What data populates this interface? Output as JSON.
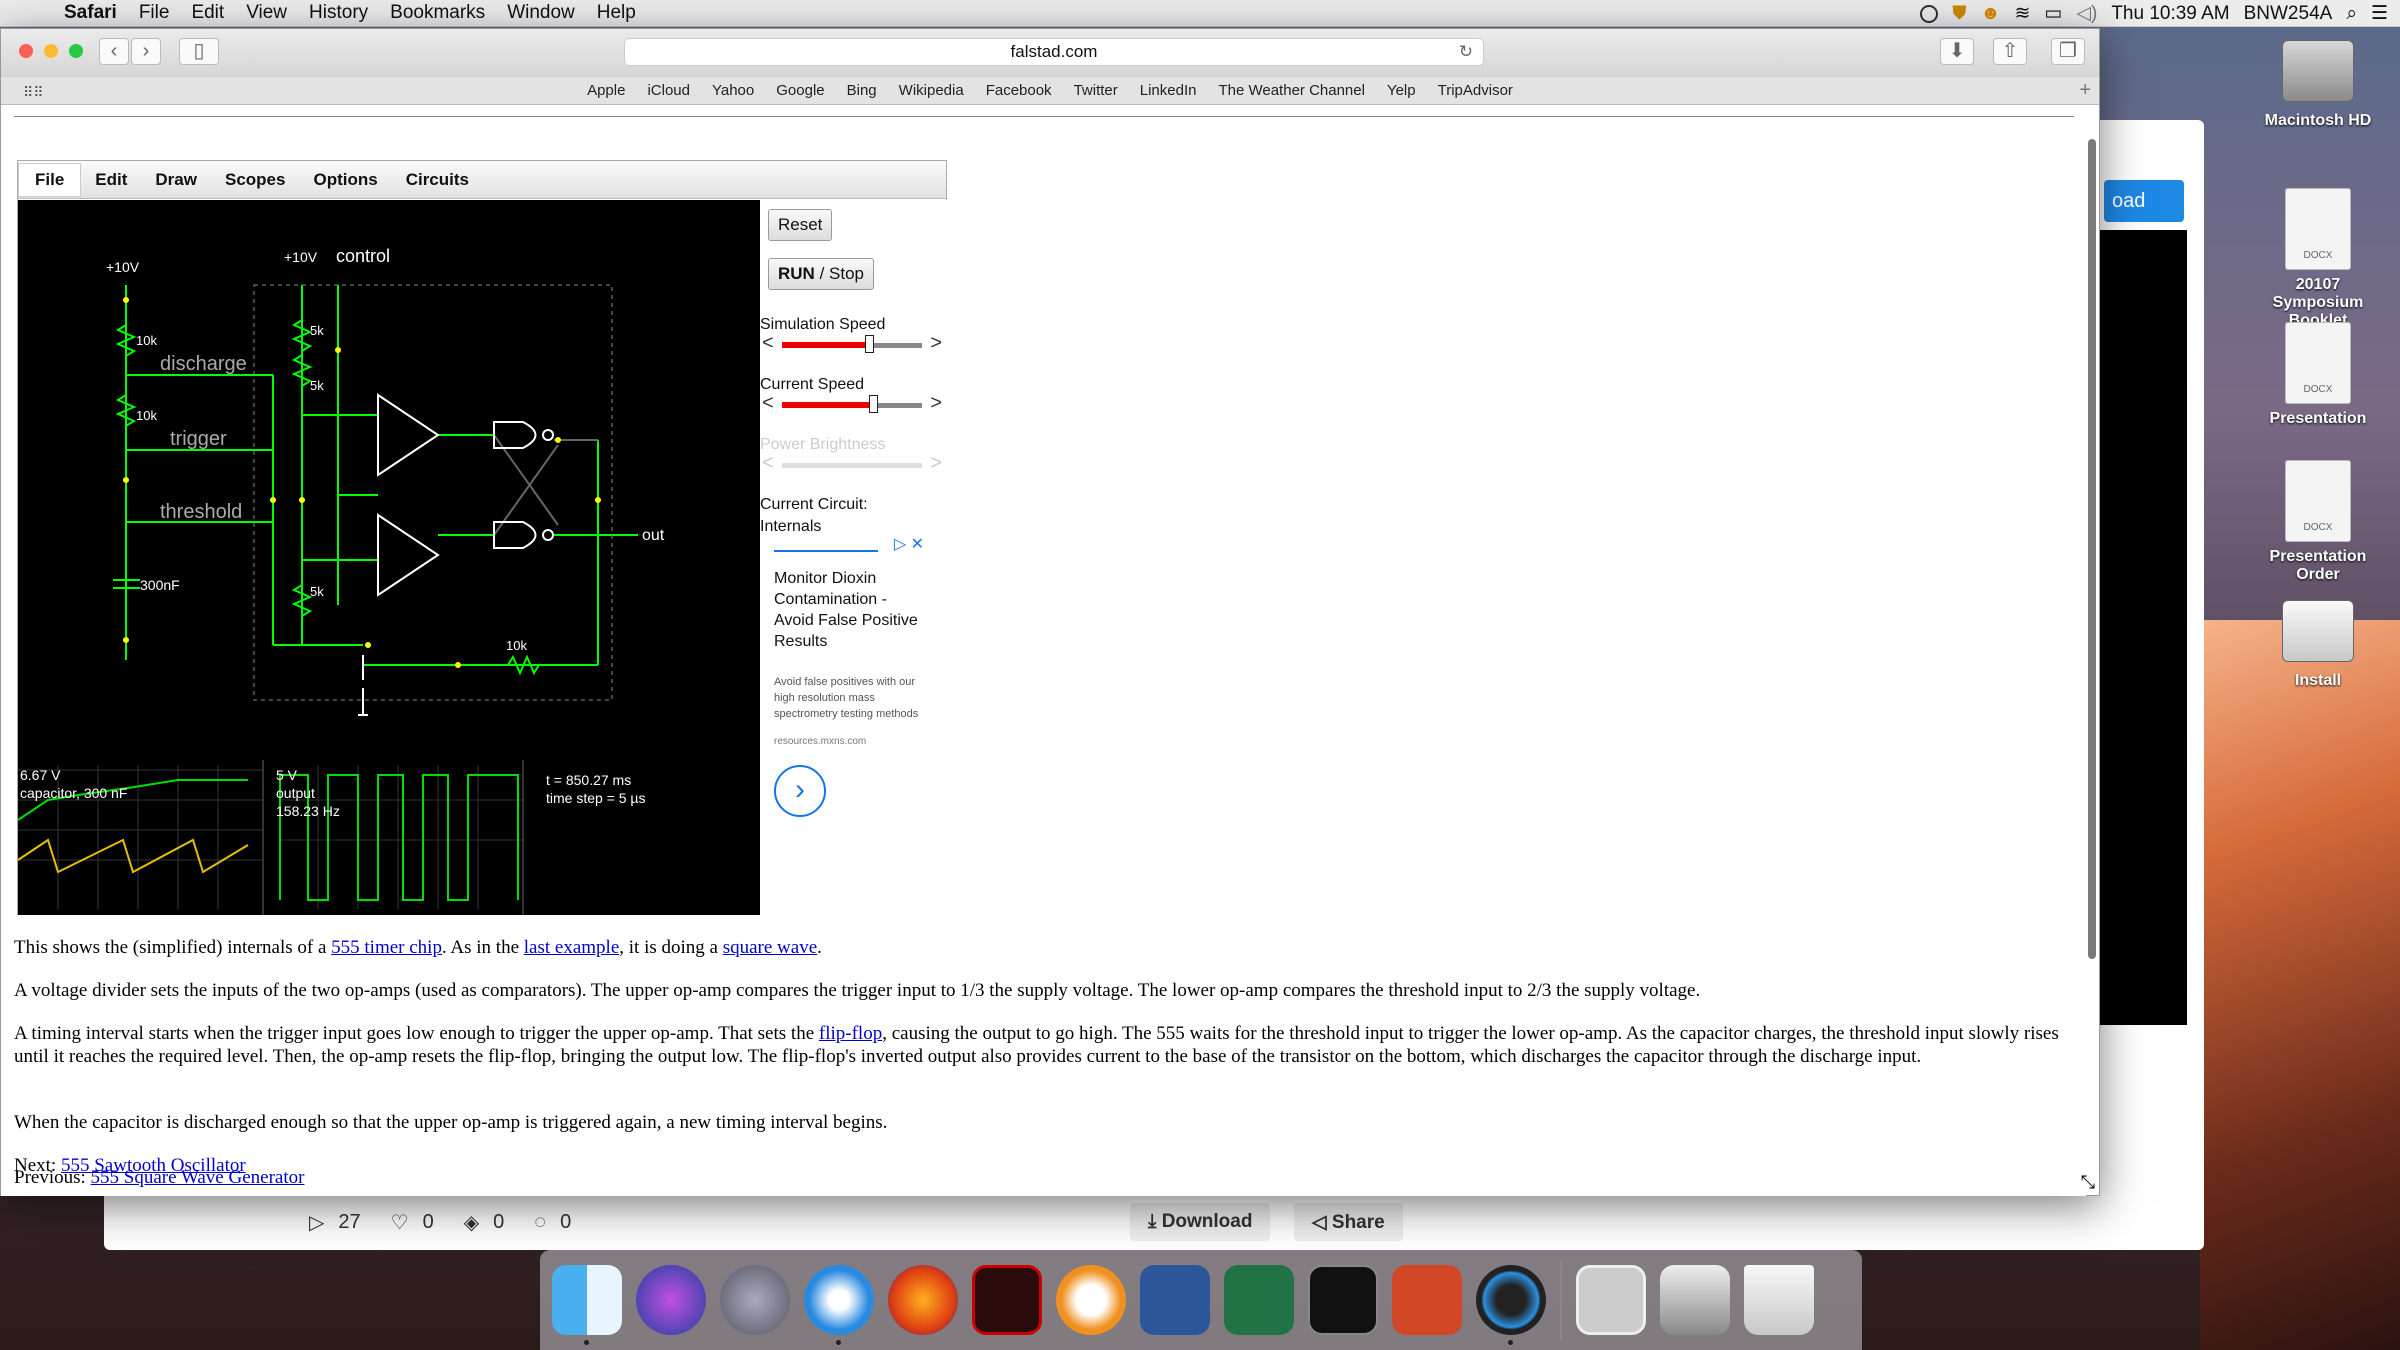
{
  "menubar": {
    "app": "Safari",
    "items": [
      "File",
      "Edit",
      "View",
      "History",
      "Bookmarks",
      "Window",
      "Help"
    ],
    "clock": "Thu 10:39 AM",
    "user": "BNW254A"
  },
  "desktop_icons": [
    {
      "label": "Macintosh HD"
    },
    {
      "label": "20107 Symposium Booklet",
      "badge": "DOCX"
    },
    {
      "label": "Presentation",
      "badge": "DOCX"
    },
    {
      "label": "Presentation Order",
      "badge": "DOCX"
    },
    {
      "label": "Install"
    }
  ],
  "bg_window": {
    "button_label": "oad",
    "plays": "27",
    "likes": "0",
    "layers": "0",
    "comments": "0",
    "download": "Download",
    "share": "Share"
  },
  "browser": {
    "url": "falstad.com",
    "favorites": [
      "Apple",
      "iCloud",
      "Yahoo",
      "Google",
      "Bing",
      "Wikipedia",
      "Facebook",
      "Twitter",
      "LinkedIn",
      "The Weather Channel",
      "Yelp",
      "TripAdvisor"
    ]
  },
  "applet": {
    "menu": [
      "File",
      "Edit",
      "Draw",
      "Scopes",
      "Options",
      "Circuits"
    ],
    "reset": "Reset",
    "run": "RUN",
    "stop": " / Stop",
    "sim_speed_label": "Simulation Speed",
    "sim_speed": 0.62,
    "current_speed_label": "Current Speed",
    "current_speed": 0.65,
    "power_brightness_label": "Power Brightness",
    "current_circuit_label": "Current Circuit:",
    "current_circuit": "Internals",
    "circuit_labels": {
      "v1": "+10V",
      "v2": "+10V",
      "control": "control",
      "r1": "10k",
      "r2": "10k",
      "r3": "5k",
      "r4": "5k",
      "r5": "5k",
      "r6": "10k",
      "discharge": "discharge",
      "trigger": "trigger",
      "threshold": "threshold",
      "cap": "300nF",
      "out": "out"
    },
    "scope1": {
      "value": "6.67 V",
      "label": "capacitor, 300 nF"
    },
    "scope2": {
      "value": "5 V",
      "label": "output",
      "freq": "158.23 Hz"
    },
    "time": "t = 850.27 ms",
    "timestep": "time step = 5 µs",
    "ad": {
      "title": "Monitor Dioxin Contamination - Avoid False Positive Results",
      "body": "Avoid false positives with our high resolution mass spectrometry testing methods",
      "source": "resources.mxns.com"
    }
  },
  "article": {
    "p1_a": "This shows the (simplified) internals of a ",
    "p1_link1": "555 timer chip",
    "p1_b": ". As in the ",
    "p1_link2": "last example",
    "p1_c": ", it is doing a ",
    "p1_link3": "square wave",
    "p1_d": ".",
    "p2": "A voltage divider sets the inputs of the two op-amps (used as comparators). The upper op-amp compares the trigger input to 1/3 the supply voltage. The lower op-amp compares the threshold input to 2/3 the supply voltage.",
    "p3_a": "A timing interval starts when the trigger input goes low enough to trigger the upper op-amp. That sets the ",
    "p3_link": "flip-flop",
    "p3_b": ", causing the output to go high. The 555 waits for the threshold input to trigger the lower op-amp. As the capacitor charges, the threshold input slowly rises until it reaches the required level. Then, the op-amp resets the flip-flop, bringing the output low. The flip-flop's inverted output also provides current to the base of the transistor on the bottom, which discharges the capacitor through the discharge input.",
    "p4": "When the capacitor is discharged enough so that the upper op-amp is triggered again, a new timing interval begins.",
    "next_label": "Next: ",
    "next_link": "555 Sawtooth Oscillator",
    "prev_label": "Previous: ",
    "prev_link": "555 Square Wave Generator"
  },
  "dock": [
    "Finder",
    "Siri",
    "Launchpad",
    "Safari",
    "Firefox",
    "Acrobat",
    "iBooks",
    "Word",
    "Excel",
    "Terminal",
    "PowerPoint",
    "QuickTime",
    "Photo",
    "Preview",
    "Trash"
  ]
}
